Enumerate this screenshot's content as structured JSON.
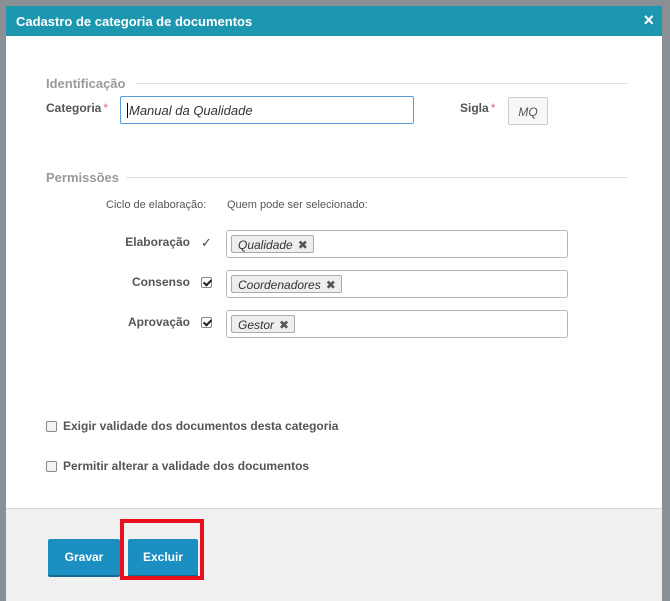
{
  "dialog": {
    "title": "Cadastro de categoria de documentos",
    "close_symbol": "×"
  },
  "identificacao": {
    "section_title": "Identificação",
    "categoria_label": "Categoria",
    "categoria_value": "Manual da Qualidade",
    "sigla_label": "Sigla",
    "sigla_value": "MQ",
    "required_marker": "*"
  },
  "permissoes": {
    "section_title": "Permissões",
    "cycle_header": "Ciclo de elaboração:",
    "who_header": "Quem pode ser selecionado:",
    "rows": [
      {
        "label": "Elaboração",
        "indicator": "✓",
        "tag": "Qualidade"
      },
      {
        "label": "Consenso",
        "checked": true,
        "tag": "Coordenadores"
      },
      {
        "label": "Aprovação",
        "checked": true,
        "tag": "Gestor"
      }
    ],
    "tag_remove_symbol": "✖"
  },
  "options": {
    "exigir_validade": {
      "label": "Exigir validade dos documentos desta categoria",
      "checked": false
    },
    "permitir_alterar": {
      "label": "Permitir alterar a validade dos documentos",
      "checked": false
    }
  },
  "footer": {
    "gravar_label": "Gravar",
    "excluir_label": "Excluir"
  },
  "colors": {
    "titlebar": "#1d96b0",
    "button": "#1c8fc2",
    "highlight": "#e8101c",
    "required": "#e0607e"
  }
}
